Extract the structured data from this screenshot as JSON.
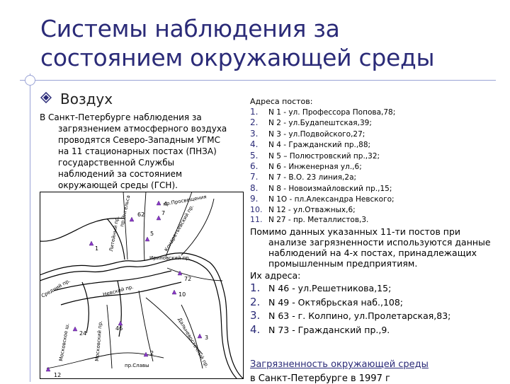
{
  "title_lines": [
    "Системы наблюдения за",
    "состоянием окружающей среды"
  ],
  "subheading": "Воздух",
  "left_paragraph": {
    "first_line": "В Санкт-Петербурге наблюдения за",
    "rest": "загрязнением атмосферного воздуха проводятся Северо-Западным УГМС на 11 стационарных постах (ПНЗА) государственной Службы наблюдений за состоянием окружающей среды (ГСН)."
  },
  "posts_heading": "Адреса постов:",
  "posts": [
    {
      "n": "1.",
      "text": "N 1 - ул. Профессора Попова,78;"
    },
    {
      "n": "2.",
      "text": "N 2 - ул.Будапештская,39;"
    },
    {
      "n": "3.",
      "text": "N 3 - ул.Подвойского,27;"
    },
    {
      "n": "4.",
      "text": "N 4 - Гражданский пр.,88;"
    },
    {
      "n": "5.",
      "text": "N 5 – Полюстровский пр.,32;"
    },
    {
      "n": "6.",
      "text": "N 6 - Инженерная ул.,6;"
    },
    {
      "n": "7.",
      "text": "N 7 - В.О. 23 линия,2а;"
    },
    {
      "n": "8.",
      "text": "N 8 - Новоизмайловский пр.,15;"
    },
    {
      "n": "9.",
      "text": "N 1О - пл.Александра Невского;"
    },
    {
      "n": "10.",
      "text": "N 12 - ул.Отважных,6;"
    },
    {
      "n": "11.",
      "text": "N 27 - пр. Металлистов,3."
    }
  ],
  "para2": {
    "first_line": "Помимо данных указанных 11-ти постов при",
    "rest": "анализе загрязненности используются данные наблюдений на 4-х постах, принадлежащих промышленным предприятиям."
  },
  "industrial_heading": "Их адреса:",
  "industrial": [
    {
      "n": "1.",
      "text": "N 46 - ул.Решетникова,15;"
    },
    {
      "n": "2.",
      "text": "N 49 - Октябрьская наб.,108;"
    },
    {
      "n": "3.",
      "text": "N 63 - г. Колпино, ул.Пролетарская,83;"
    },
    {
      "n": "4.",
      "text": "N 73 - Гражданский пр.,9."
    }
  ],
  "link_text": "Загрязненность окружающей среды",
  "footer_text": "в Санкт-Петербурге в 1997 г",
  "map": {
    "post_numbers": [
      "4",
      "62",
      "7",
      "5",
      "1",
      "72",
      "10",
      "24",
      "46",
      "3",
      "2",
      "12"
    ],
    "street_labels": [
      "пр.Энгельса",
      "Литейный пр.",
      "пр.Просвещения",
      "Кондратьевский пр.",
      "Ириновский пр.",
      "Средний пр.",
      "Невский пр.",
      "Московский пр.",
      "пр.Славы",
      "Московское ш.",
      "Дальневосточный пр."
    ],
    "colors": {
      "markers": "#8b39c9",
      "lines": "#000000"
    }
  },
  "colors": {
    "title": "#2b2b78",
    "accent": "#2b2b78",
    "rule": "#9aa3d6"
  }
}
